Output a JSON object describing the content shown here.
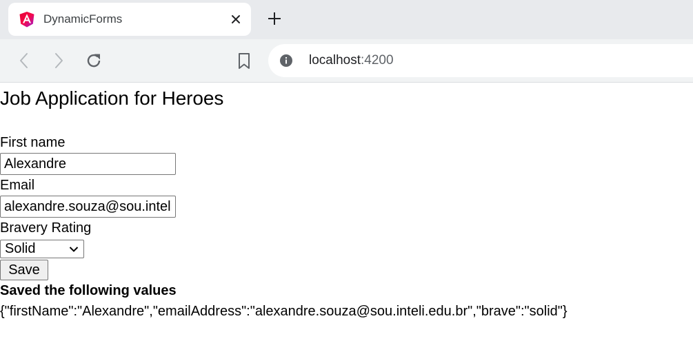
{
  "browser": {
    "tab": {
      "title": "DynamicForms",
      "favicon": "angular-logo-icon"
    },
    "address_bar": {
      "host": "localhost",
      "port": ":4200"
    }
  },
  "page": {
    "title": "Job Application for Heroes",
    "form": {
      "first_name": {
        "label": "First name",
        "value": "Alexandre"
      },
      "email": {
        "label": "Email",
        "value": "alexandre.souza@sou.inteli.edu.br"
      },
      "bravery": {
        "label": "Bravery Rating",
        "selected": "Solid"
      },
      "save_label": "Save"
    },
    "result": {
      "heading": "Saved the following values",
      "payload": "{\"firstName\":\"Alexandre\",\"emailAddress\":\"alexandre.souza@sou.inteli.edu.br\",\"brave\":\"solid\"}"
    }
  },
  "colors": {
    "tabstrip": "#e8eaed",
    "toolbar": "#f1f3f4",
    "icon": "#5f6368",
    "angular_red": "#dd0031",
    "angular_magenta": "#c3002f"
  }
}
